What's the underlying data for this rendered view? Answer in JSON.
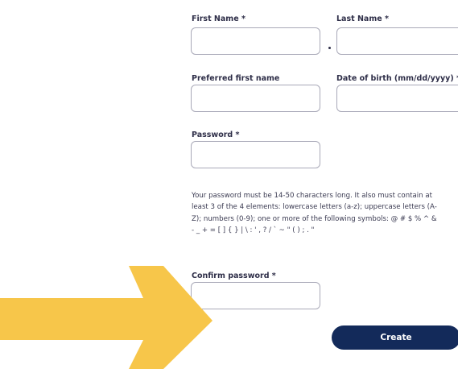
{
  "form": {
    "first_name_label": "First Name *",
    "last_name_label": "Last Name *",
    "preferred_first_name_label": "Preferred first name",
    "dob_label": "Date of birth (mm/dd/yyyy) *",
    "password_label": "Password *",
    "password_rules": [
      "Your password must be 14-50 characters long. It also must contain at",
      "least 3 of the 4 elements: lowercase letters (a-z); uppercase letters (A-",
      "Z); numbers (0-9); one or more of the following symbols: @ # $ % ^ &",
      "- _ + = [ ] { } | \\ : ' , ? / ` ~ \" ( ) ; . \""
    ],
    "confirm_password_label": "Confirm password *",
    "create_label": "Create"
  },
  "annotation": {
    "arrow_icon": "arrow-right-icon",
    "arrow_color": "#f7c64a"
  },
  "colors": {
    "button_bg": "#132a5a",
    "field_border": "#a9a9b8"
  }
}
